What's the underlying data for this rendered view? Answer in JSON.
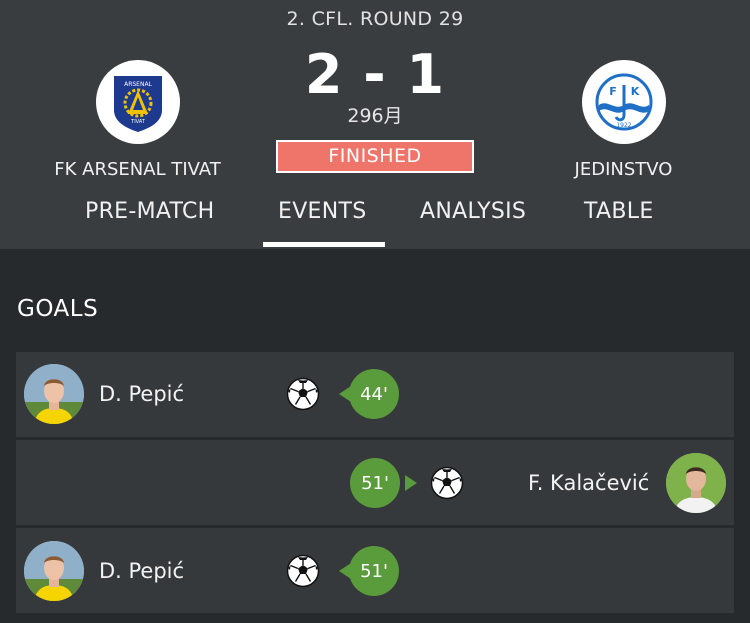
{
  "match": {
    "round": "2. CFL. ROUND 29",
    "score": "2 - 1",
    "date": "296月",
    "status": "FINISHED",
    "home_team": "FK ARSENAL TIVAT",
    "away_team": "JEDINSTVO"
  },
  "home_logo": {
    "top_text": "ARSENAL",
    "bottom_text": "TIVAT"
  },
  "away_logo": {
    "letters": [
      "F",
      "K"
    ],
    "year": "1922"
  },
  "tabs": [
    "PRE-MATCH",
    "EVENTS",
    "ANALYSIS",
    "TABLE"
  ],
  "active_tab": "EVENTS",
  "goals_section": {
    "title": "GOALS",
    "events": [
      {
        "side": "home",
        "player": "D. Pepić",
        "minute": "44'"
      },
      {
        "side": "away",
        "player": "F. Kalačević",
        "minute": "51'"
      },
      {
        "side": "home",
        "player": "D. Pepić",
        "minute": "51'"
      }
    ]
  },
  "colors": {
    "header_bg": "#3a3d40",
    "page_bg": "#272a2d",
    "row_bg": "#36393c",
    "finished": "#ef7469",
    "minute_badge": "#5a9b3c"
  }
}
